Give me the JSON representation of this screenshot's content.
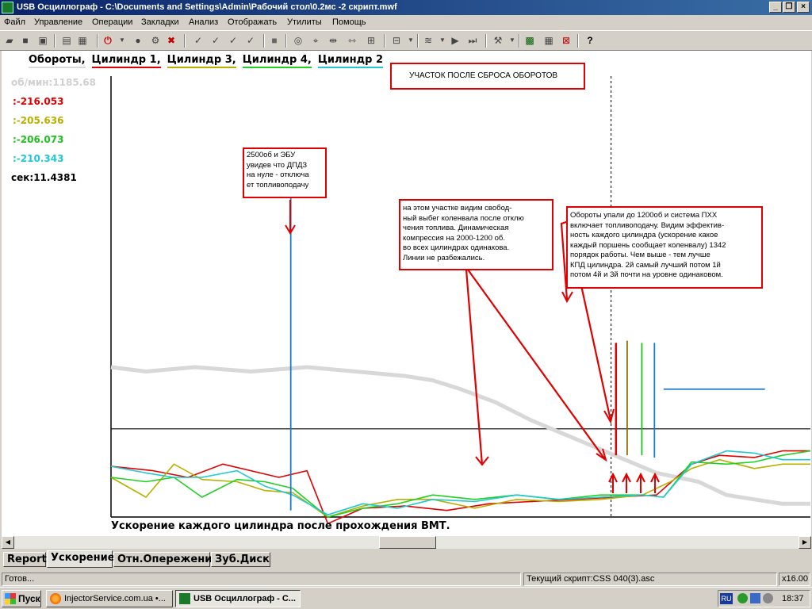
{
  "window": {
    "title": "USB Осциллограф - C:\\Documents and Settings\\Admin\\Рабочий стол\\0.2мс -2 скрипт.mwf"
  },
  "menu": [
    "Файл",
    "Управление",
    "Операции",
    "Закладки",
    "Анализ",
    "Отображать",
    "Утилиты",
    "Помощь"
  ],
  "legend": [
    {
      "label": "Обороты,",
      "color": "#d8d8d8"
    },
    {
      "label": "Цилиндр 1,",
      "color": "#e00000"
    },
    {
      "label": "Цилиндр 3,",
      "color": "#b8b000"
    },
    {
      "label": "Цилиндр 4,",
      "color": "#20d020"
    },
    {
      "label": "Цилиндр 2",
      "color": "#20c8d0"
    }
  ],
  "readouts": {
    "rpm": "об/мин:1185.68",
    "c1": ":-216.053",
    "c3": ":-205.636",
    "c4": ":-206.073",
    "c2": ":-210.343",
    "time": "сек:11.4381"
  },
  "annotations": {
    "title": "УЧАСТОК ПОСЛЕ СБРОСА ОБОРОТОВ",
    "note1": [
      "2500об и ЭБУ",
      "увидев что ДПДЗ",
      "на нуле - отключа",
      "ет топливоподачу"
    ],
    "note2": [
      "на этом участке видим свобод-",
      "ный выбег коленвала после отклю",
      "чения топлива. Динамическая",
      "компрессия на 2000-1200 об.",
      "во всех цилиндрах одинакова.",
      "Линии не разбежались."
    ],
    "note3": [
      "Обороты упали до 1200об и система ПХХ",
      "включает топливоподачу. Видим эффектив-",
      "ность каждого цилиндра (ускорение какое",
      "каждый поршень сообщает коленвалу) 1342",
      "порядок работы. Чем выше - тем лучше",
      "КПД цилиндра. 2й самый лучший потом 1й",
      "потом 4й и 3й почти на уровне одинаковом."
    ]
  },
  "caption": "Ускорение каждого цилиндра после прохождения ВМТ.",
  "tabs": [
    "Report",
    "Ускорение",
    "Отн.Опережение",
    "Зуб.Диск"
  ],
  "status": {
    "ready": "Готов...",
    "script": "Текущий скрипт:CSS 040(3).asc",
    "zoom": "x16.00"
  },
  "taskbar": {
    "start": "Пуск",
    "tasks": [
      "InjectorService.com.ua •...",
      "USB Осциллограф - C..."
    ],
    "lang": "RU",
    "clock": "18:37"
  },
  "chart_data": {
    "type": "line",
    "series": [
      {
        "name": "Обороты",
        "color": "#d8d8d8",
        "points": [
          [
            0,
            66
          ],
          [
            5,
            67
          ],
          [
            12,
            66
          ],
          [
            20,
            67
          ],
          [
            28,
            66
          ],
          [
            35,
            67
          ],
          [
            42,
            68
          ],
          [
            46,
            69
          ],
          [
            50,
            71
          ],
          [
            55,
            74
          ],
          [
            60,
            78
          ],
          [
            66,
            82
          ],
          [
            72,
            86
          ],
          [
            78,
            90
          ],
          [
            84,
            92
          ],
          [
            88,
            95
          ],
          [
            92,
            96
          ],
          [
            96,
            97
          ],
          [
            100,
            97
          ]
        ]
      },
      {
        "name": "Цилиндр 1",
        "color": "#e00000",
        "points": [
          [
            0,
            88.5
          ],
          [
            6,
            89.5
          ],
          [
            11,
            91
          ],
          [
            16,
            88
          ],
          [
            20,
            89.5
          ],
          [
            24,
            91
          ],
          [
            28,
            89.5
          ],
          [
            31,
            101.5
          ],
          [
            36,
            98
          ],
          [
            42,
            97.5
          ],
          [
            48,
            98.5
          ],
          [
            54,
            97
          ],
          [
            60,
            96.5
          ],
          [
            66,
            96
          ],
          [
            72,
            95.5
          ],
          [
            78,
            95
          ],
          [
            83,
            88
          ],
          [
            87,
            86
          ],
          [
            92,
            86.5
          ],
          [
            96,
            85
          ],
          [
            100,
            85
          ]
        ]
      },
      {
        "name": "Цилиндр 3",
        "color": "#b8b000",
        "points": [
          [
            0,
            91
          ],
          [
            5,
            95.5
          ],
          [
            9,
            88
          ],
          [
            13,
            91.5
          ],
          [
            18,
            92
          ],
          [
            22,
            94
          ],
          [
            26,
            94.5
          ],
          [
            31,
            100
          ],
          [
            36,
            97.5
          ],
          [
            41,
            96
          ],
          [
            46,
            96
          ],
          [
            52,
            98
          ],
          [
            58,
            96
          ],
          [
            64,
            96.5
          ],
          [
            70,
            96
          ],
          [
            76,
            95
          ],
          [
            80,
            92
          ],
          [
            83,
            89
          ],
          [
            87,
            87
          ],
          [
            92,
            89
          ],
          [
            96,
            88
          ],
          [
            100,
            88
          ]
        ]
      },
      {
        "name": "Цилиндр 4",
        "color": "#20d020",
        "points": [
          [
            0,
            91
          ],
          [
            5,
            92
          ],
          [
            9,
            91
          ],
          [
            13,
            95.5
          ],
          [
            18,
            91.5
          ],
          [
            22,
            92
          ],
          [
            26,
            93.5
          ],
          [
            31,
            100
          ],
          [
            36,
            98
          ],
          [
            41,
            97
          ],
          [
            46,
            95
          ],
          [
            52,
            96
          ],
          [
            58,
            95
          ],
          [
            64,
            96
          ],
          [
            70,
            95
          ],
          [
            76,
            95
          ],
          [
            79,
            95.5
          ],
          [
            83,
            87.5
          ],
          [
            88,
            88
          ],
          [
            92,
            87.5
          ],
          [
            96,
            86
          ],
          [
            100,
            85
          ]
        ]
      },
      {
        "name": "Цилиндр 2",
        "color": "#20c8d0",
        "points": [
          [
            0,
            88.5
          ],
          [
            5,
            90
          ],
          [
            9,
            91
          ],
          [
            13,
            91
          ],
          [
            18,
            89.5
          ],
          [
            22,
            93
          ],
          [
            26,
            95
          ],
          [
            31,
            99.5
          ],
          [
            36,
            97
          ],
          [
            41,
            98
          ],
          [
            46,
            96
          ],
          [
            52,
            96.5
          ],
          [
            58,
            95
          ],
          [
            64,
            96
          ],
          [
            70,
            95.5
          ],
          [
            76,
            95
          ],
          [
            79,
            95.5
          ],
          [
            83,
            88
          ],
          [
            88,
            85
          ],
          [
            92,
            85.5
          ],
          [
            96,
            87
          ],
          [
            100,
            87
          ]
        ]
      }
    ]
  }
}
